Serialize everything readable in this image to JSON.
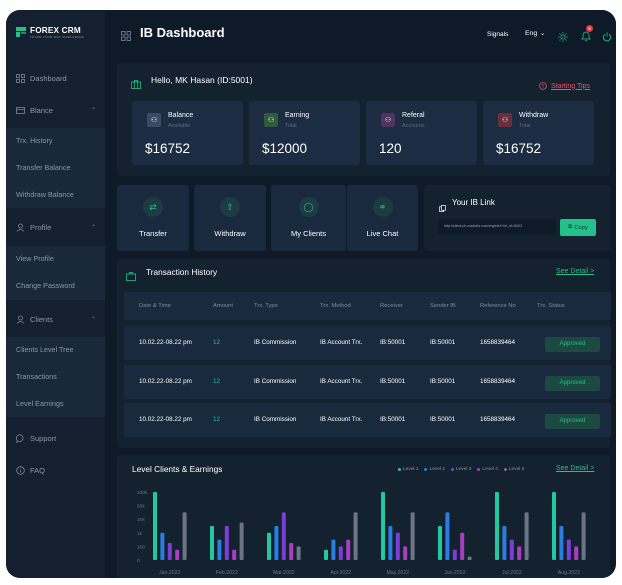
{
  "app": {
    "logo_title": "FOREX CRM",
    "logo_subtitle": "TRADE YOUR WAY WORLDWIDE",
    "page_title": "IB Dashboard"
  },
  "topbar": {
    "signals_label": "Signals",
    "language_label": "Eng",
    "notification_count": "9"
  },
  "sidebar": {
    "dashboard": "Dashboard",
    "balance": "Blance",
    "balance_items": [
      "Trx. History",
      "Transfer Balance",
      "Withdraw Balance"
    ],
    "profile": "Profile",
    "profile_items": [
      "View Profile",
      "Change Password"
    ],
    "clients": "Clients",
    "clients_items": [
      "Clients Level Tree",
      "Transactions",
      "Level Earnings"
    ],
    "support": "Support",
    "faq": "FAQ"
  },
  "welcome": {
    "greeting": "Hello, MK Hasan (ID:5001)",
    "tips_link": "Starting Tips"
  },
  "stats": [
    {
      "label": "Balance",
      "sub": "Available",
      "value": "$16752",
      "icon": "wallet-icon",
      "color": "#3a4b63"
    },
    {
      "label": "Earning",
      "sub": "Total",
      "value": "$12000",
      "icon": "earning-icon",
      "color": "#2f5a3c"
    },
    {
      "label": "Referal",
      "sub": "Accounts",
      "value": "120",
      "icon": "referral-icon",
      "color": "#4f3360"
    },
    {
      "label": "Withdraw",
      "sub": "Total",
      "value": "$16752",
      "icon": "withdraw-icon",
      "color": "#6a2f3a"
    }
  ],
  "actions": [
    {
      "label": "Transfer",
      "icon": "transfer-icon"
    },
    {
      "label": "Withdraw",
      "icon": "upload-icon"
    },
    {
      "label": "My Clients",
      "icon": "user-icon"
    },
    {
      "label": "Live Chat",
      "icon": "chat-icon"
    }
  ],
  "ib_link": {
    "title": "Your IB Link",
    "url": "http://client.ph.markets.com/register?ref_id=5003",
    "copy_label": "Copy"
  },
  "transactions": {
    "title": "Transaction History",
    "see_detail": "See Detail >",
    "headers": [
      "Date & Time",
      "Amount",
      "Trx. Type",
      "Trx. Method",
      "Receiver",
      "Sender IB",
      "Reference No",
      "Trx. Status"
    ],
    "rows": [
      [
        "10.02.22-08.22 pm",
        "12",
        "IB Commission",
        "IB Account Trx.",
        "IB:50001",
        "IB:50001",
        "1658839464",
        "Approved"
      ],
      [
        "10.02.22-08.22 pm",
        "12",
        "IB Commission",
        "IB Account Trx.",
        "IB:50001",
        "IB:50001",
        "1658839464",
        "Approved"
      ],
      [
        "10.02.22-08.22 pm",
        "12",
        "IB Commission",
        "IB Account Trx.",
        "IB:50001",
        "IB:50001",
        "1658839464",
        "Approved"
      ]
    ]
  },
  "level_chart": {
    "title": "Level Clients & Earnings",
    "see_detail": "See Detail >"
  },
  "chart_data": {
    "type": "bar",
    "title": "Level Clients & Earnings",
    "categories": [
      "Jan.2022",
      "Feb.2022",
      "Mar.2022",
      "Apr.2022",
      "May.2022",
      "Jun.2022",
      "Jul.2022",
      "Aug.2022"
    ],
    "yticks": [
      "100k",
      "50k",
      "10k",
      "1k",
      "100",
      "0"
    ],
    "ylim": [
      0,
      100000
    ],
    "series": [
      {
        "name": "Level 1",
        "color": "#22c9a0",
        "values": [
          100000,
          50000,
          40000,
          15000,
          100000,
          50000,
          100000,
          100000
        ]
      },
      {
        "name": "Level 2",
        "color": "#2a7de1",
        "values": [
          40000,
          30000,
          50000,
          30000,
          50000,
          70000,
          50000,
          50000
        ]
      },
      {
        "name": "Level 3",
        "color": "#7b3fd6",
        "values": [
          25000,
          50000,
          70000,
          20000,
          40000,
          15000,
          30000,
          30000
        ]
      },
      {
        "name": "Level 4",
        "color": "#a73fc0",
        "values": [
          15000,
          15000,
          25000,
          30000,
          20000,
          40000,
          20000,
          20000
        ]
      },
      {
        "name": "Level 5",
        "color": "#6b7585",
        "values": [
          70000,
          55000,
          20000,
          70000,
          70000,
          5000,
          70000,
          70000
        ]
      }
    ],
    "legend_position": "top-right",
    "grid": false
  }
}
